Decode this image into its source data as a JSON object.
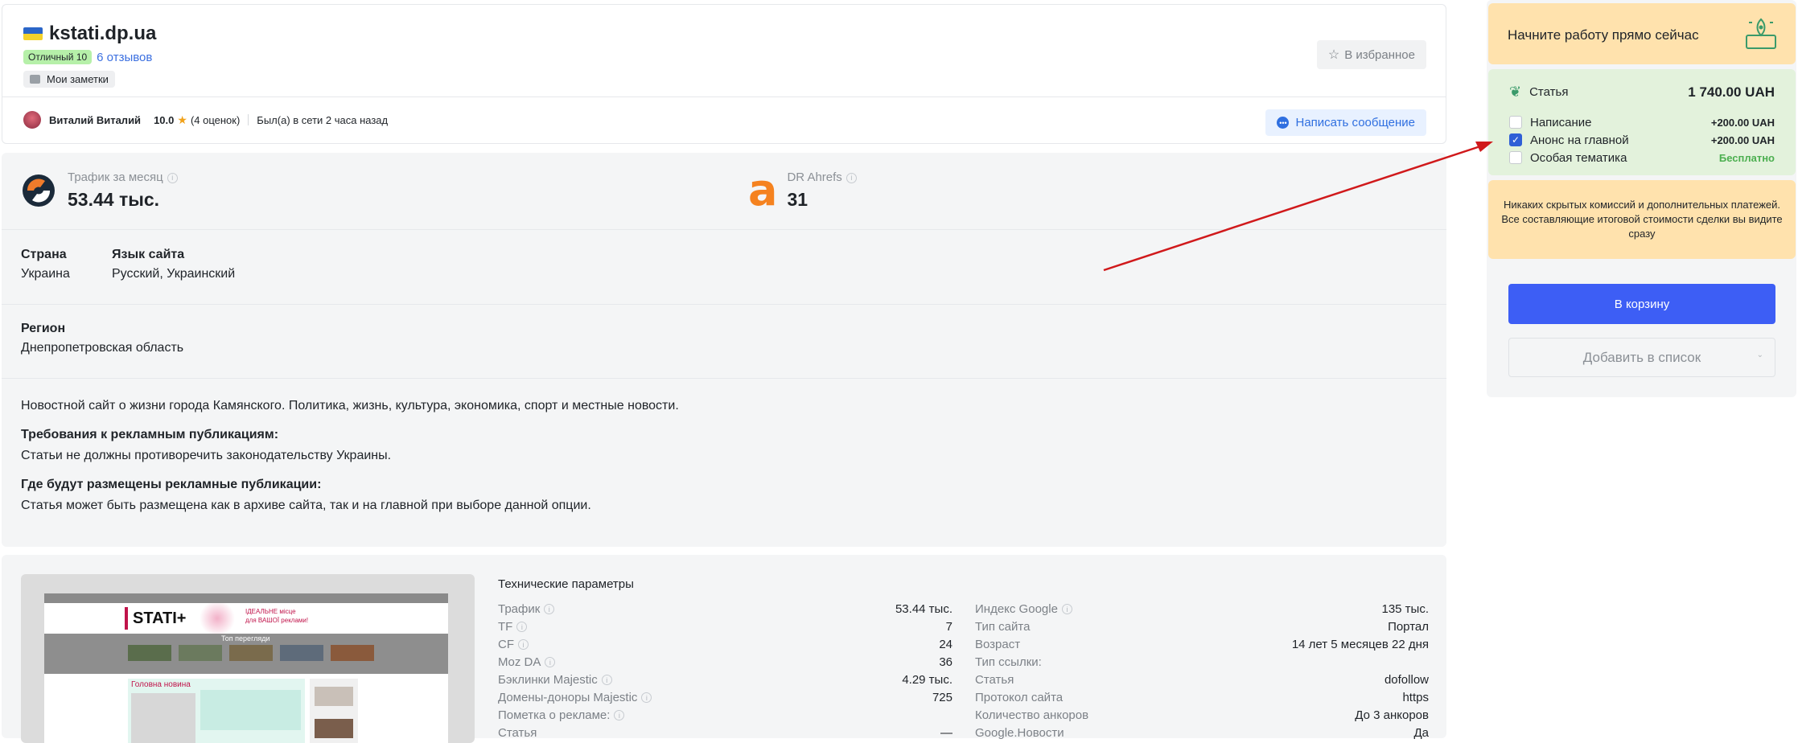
{
  "header": {
    "site": "kstati.dp.ua",
    "rating_badge": "Отличный 10",
    "reviews_link": "6 отзывов",
    "notes_chip": "Мои заметки",
    "fav_button": "В избранное",
    "owner_name": "Виталий Виталий",
    "owner_score": "10.0",
    "owner_ratings": "(4 оценок)",
    "owner_status": "Был(а) в сети 2 часа назад",
    "message_button": "Написать сообщение"
  },
  "metrics": {
    "traffic_label": "Трафик за месяц",
    "traffic_value": "53.44 тыс.",
    "dr_label": "DR Ahrefs",
    "dr_value": "31"
  },
  "info": {
    "country_label": "Страна",
    "country_value": "Украина",
    "lang_label": "Язык сайта",
    "lang_value": "Русский, Украинский",
    "region_label": "Регион",
    "region_value": "Днепропетровская область"
  },
  "description": {
    "text": "Новостной сайт о жизни города Камянского. Политика, жизнь, культура, экономика, спорт и местные новости.",
    "req_title": "Требования к рекламным публикациям:",
    "req_text": "Статьи не должны противоречить законодательству Украины.",
    "where_title": "Где будут размещены рекламные публикации:",
    "where_text": "Статья может быть размещена как в архиве сайта, так и на главной при выборе данной опции."
  },
  "tech": {
    "title": "Технические параметры",
    "left": [
      {
        "k": "Трафик",
        "v": "53.44 тыс.",
        "q": true
      },
      {
        "k": "TF",
        "v": "7",
        "q": true
      },
      {
        "k": "CF",
        "v": "24",
        "q": true
      },
      {
        "k": "Moz DA",
        "v": "36",
        "q": true
      },
      {
        "k": "Бэклинки Majestic",
        "v": "4.29 тыс.",
        "q": true
      },
      {
        "k": "Домены-доноры Majestic",
        "v": "725",
        "q": true
      },
      {
        "k": "Пометка о рекламе:",
        "v": "",
        "q": true
      },
      {
        "k": "Статья",
        "v": "—",
        "q": false
      }
    ],
    "right": [
      {
        "k": "Индекс Google",
        "v": "135 тыс.",
        "q": true
      },
      {
        "k": "Тип сайта",
        "v": "Портал",
        "q": false
      },
      {
        "k": "Возраст",
        "v": "14 лет 5 месяцев 22 дня",
        "q": false
      },
      {
        "k": "Тип ссылки:",
        "v": "",
        "q": false
      },
      {
        "k": "Статья",
        "v": "dofollow",
        "q": false
      },
      {
        "k": "Протокол сайта",
        "v": "https",
        "q": false
      },
      {
        "k": "Количество анкоров",
        "v": "До 3 анкоров",
        "q": false
      },
      {
        "k": "Google.Новости",
        "v": "Да",
        "q": false
      }
    ]
  },
  "thumbnail": {
    "logo_text": "STATI+",
    "ad_line1": "ІДЕАЛЬНЕ місце",
    "ad_line2": "для ВАШОЇ реклами!",
    "top_caption": "Топ перегляди",
    "main_news": "Головна новина"
  },
  "sidebar": {
    "start_title": "Начните работу прямо сейчас",
    "product_label": "Статья",
    "product_price": "1 740.00 UAH",
    "options": [
      {
        "label": "Написание",
        "price": "+200.00 UAH",
        "checked": false,
        "free": false
      },
      {
        "label": "Анонс на главной",
        "price": "+200.00 UAH",
        "checked": true,
        "free": false
      },
      {
        "label": "Особая тематика",
        "price": "Бесплатно",
        "checked": false,
        "free": true
      }
    ],
    "notice": "Никаких скрытых комиссий и дополнительных платежей. Все составляющие итоговой стоимости сделки вы видите сразу",
    "cart_button": "В корзину",
    "list_button": "Добавить в список"
  },
  "colors": {
    "accent": "#3d5ef5",
    "start_bg": "#ffe2ad",
    "options_bg": "#e3f2dc",
    "badge_green": "#b6f0a9",
    "arrow": "#d0191b"
  }
}
